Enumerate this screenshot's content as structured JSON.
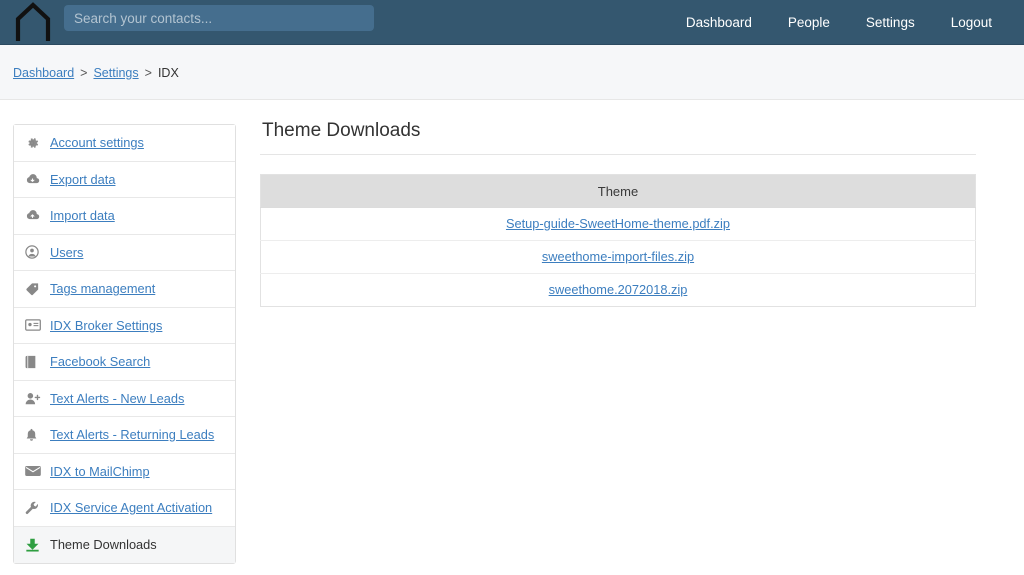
{
  "navbar": {
    "logo_icon": "home-arch-logo-icon",
    "search": {
      "placeholder": "Search your contacts...",
      "value": ""
    },
    "links": [
      {
        "label": "Dashboard"
      },
      {
        "label": "People"
      },
      {
        "label": "Settings"
      },
      {
        "label": "Logout"
      }
    ]
  },
  "breadcrumb": {
    "items": [
      {
        "label": "Dashboard",
        "link": true
      },
      {
        "label": "Settings",
        "link": true
      },
      {
        "label": "IDX",
        "link": false
      }
    ],
    "separator": ">"
  },
  "sidebar": {
    "items": [
      {
        "label": "Account settings",
        "icon": "gear-icon",
        "active": false
      },
      {
        "label": "Export data",
        "icon": "cloud-download-icon",
        "active": false
      },
      {
        "label": "Import data",
        "icon": "cloud-upload-icon",
        "active": false
      },
      {
        "label": "Users",
        "icon": "user-circle-icon",
        "active": false
      },
      {
        "label": "Tags management",
        "icon": "tag-icon",
        "active": false
      },
      {
        "label": "IDX Broker Settings",
        "icon": "id-card-icon",
        "active": false
      },
      {
        "label": "Facebook Search",
        "icon": "book-icon",
        "active": false
      },
      {
        "label": "Text Alerts - New Leads",
        "icon": "user-plus-icon",
        "active": false
      },
      {
        "label": "Text Alerts - Returning Leads",
        "icon": "bell-icon",
        "active": false
      },
      {
        "label": "IDX to MailChimp",
        "icon": "envelope-icon",
        "active": false
      },
      {
        "label": "IDX Service Agent Activation",
        "icon": "wrench-icon",
        "active": false
      },
      {
        "label": "Theme Downloads",
        "icon": "download-icon-green",
        "active": true
      }
    ]
  },
  "main": {
    "title": "Theme Downloads",
    "table": {
      "columns": [
        "Theme"
      ],
      "rows": [
        {
          "theme": "Setup-guide-SweetHome-theme.pdf.zip"
        },
        {
          "theme": "sweethome-import-files.zip"
        },
        {
          "theme": "sweethome.2072018.zip"
        }
      ]
    }
  },
  "colors": {
    "navbar_bg": "#34576f",
    "search_bg": "#456e8e",
    "link_blue": "#3c7ebf",
    "breadcrumb_bg": "#f6f7f9",
    "table_header_bg": "#dddddd",
    "active_row_bg": "#f5f6f7",
    "download_icon_green": "#2f9e41"
  }
}
